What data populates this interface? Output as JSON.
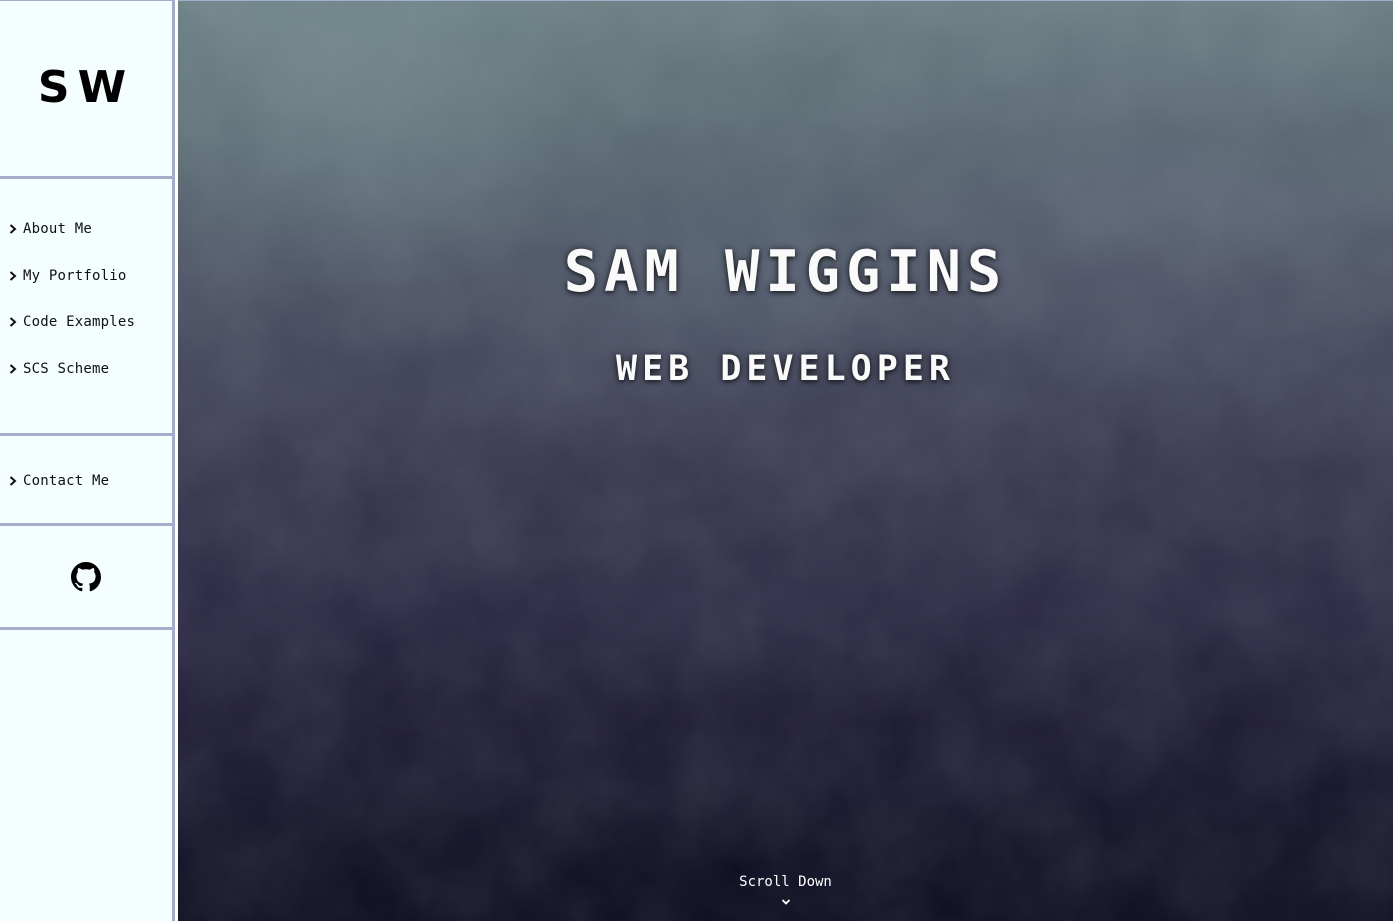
{
  "sidebar": {
    "logo": "SW",
    "nav_items": [
      {
        "label": "About Me",
        "icon": "chevron-right-icon"
      },
      {
        "label": "My Portfolio",
        "icon": "chevron-right-icon"
      },
      {
        "label": "Code Examples",
        "icon": "chevron-right-icon"
      },
      {
        "label": "SCS Scheme",
        "icon": "chevron-right-icon"
      }
    ],
    "contact": {
      "label": "Contact Me",
      "icon": "chevron-right-icon"
    },
    "social": {
      "icon": "github-icon"
    }
  },
  "hero": {
    "name": "SAM WIGGINS",
    "role": "WEB DEVELOPER",
    "scroll_label": "Scroll Down",
    "scroll_icon": "chevron-down-icon"
  },
  "colors": {
    "sidebar_bg": "#f5fefe",
    "divider": "#a3acc8",
    "hero_top": "#6a7f83",
    "hero_bottom": "#0b0a1d",
    "hero_text": "#fafafa"
  }
}
